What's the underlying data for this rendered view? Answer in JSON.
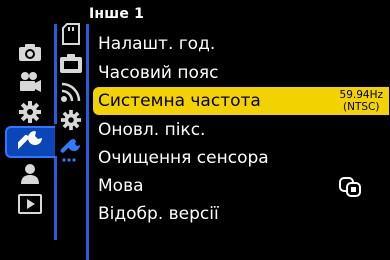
{
  "page": {
    "title": "Інше 1"
  },
  "main_tabs": [
    {
      "icon": "camera-icon",
      "active": false
    },
    {
      "icon": "video-camera-icon",
      "active": false
    },
    {
      "icon": "gear-icon",
      "active": false
    },
    {
      "icon": "wrench-icon",
      "active": true
    },
    {
      "icon": "person-icon",
      "active": false
    },
    {
      "icon": "playback-icon",
      "active": false
    }
  ],
  "sub_tabs": [
    {
      "icon": "card-icon"
    },
    {
      "icon": "monitor-icon"
    },
    {
      "icon": "wireless-icon"
    },
    {
      "icon": "gear-icon"
    },
    {
      "icon": "wrench-dots-icon"
    }
  ],
  "menu": {
    "items": [
      {
        "label": "Налашт. год."
      },
      {
        "label": "Часовий пояс"
      },
      {
        "label": "Системна частота",
        "selected": true,
        "value_line1": "59.94Hz",
        "value_line2": "(NTSC)"
      },
      {
        "label": "Оновл. пікс."
      },
      {
        "label": "Очищення сенсора"
      },
      {
        "label": "Мова",
        "value_icon": "language-icon"
      },
      {
        "label": "Відобр. версії"
      }
    ]
  },
  "colors": {
    "background": "#000000",
    "highlight": "#f2d200",
    "accent_blue": "#1f5fe0",
    "active_tab": "#0a46b8"
  }
}
